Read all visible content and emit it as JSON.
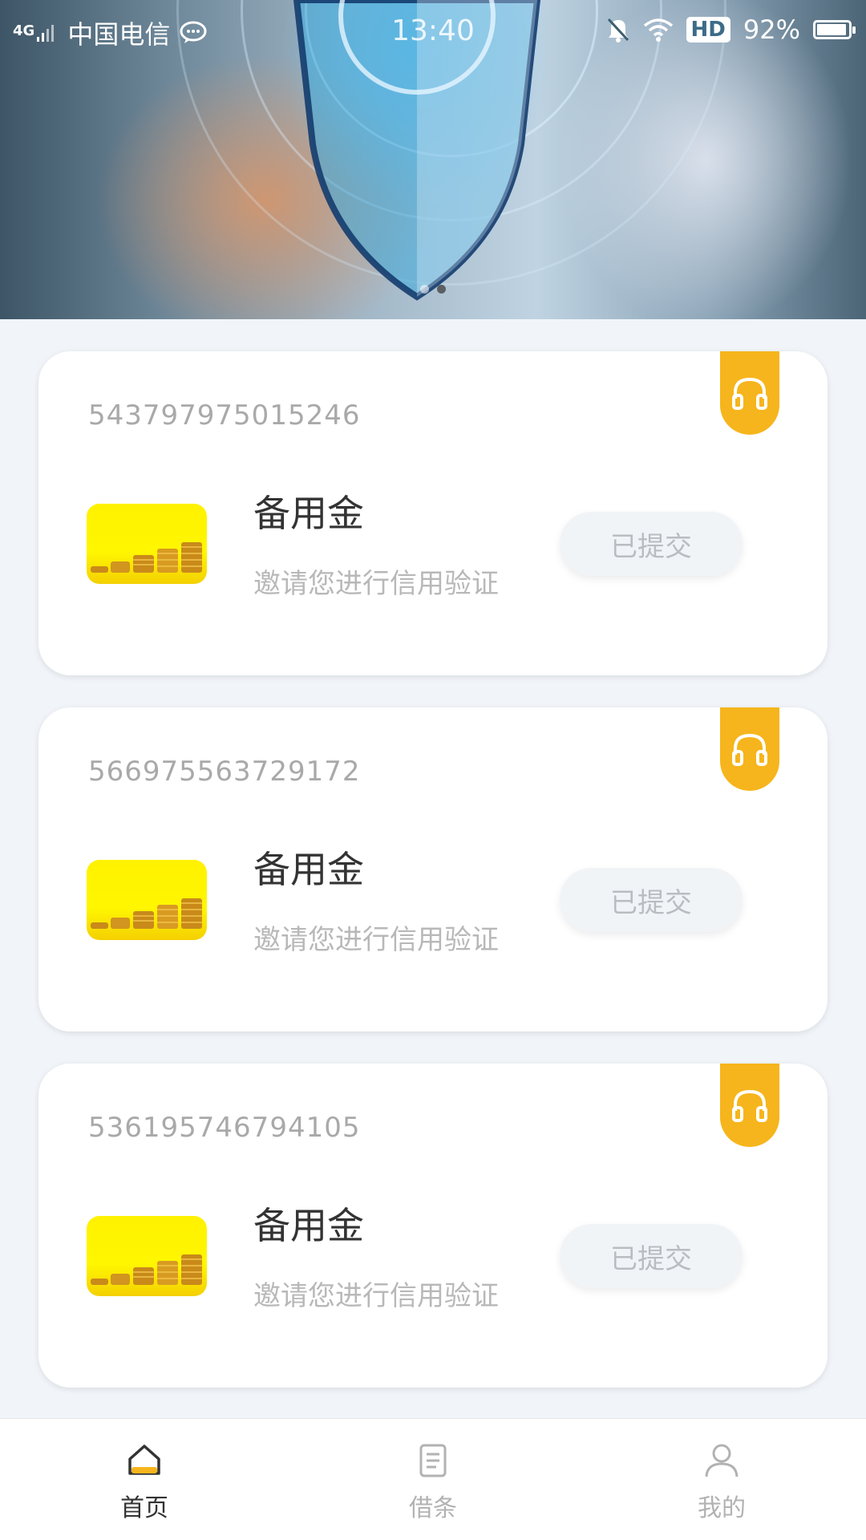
{
  "status_bar": {
    "network": "4G",
    "carrier": "中国电信",
    "time": "13:40",
    "hd": "HD",
    "battery": "92%"
  },
  "banner": {
    "page_count": 2,
    "active_index": 1
  },
  "cards": [
    {
      "number": "543797975015246",
      "title": "备用金",
      "description": "邀请您进行信用验证",
      "button": "已提交"
    },
    {
      "number": "566975563729172",
      "title": "备用金",
      "description": "邀请您进行信用验证",
      "button": "已提交"
    },
    {
      "number": "536195746794105",
      "title": "备用金",
      "description": "邀请您进行信用验证",
      "button": "已提交"
    }
  ],
  "tabs": [
    {
      "label": "首页",
      "icon": "home-icon",
      "active": true
    },
    {
      "label": "借条",
      "icon": "document-icon",
      "active": false
    },
    {
      "label": "我的",
      "icon": "person-icon",
      "active": false
    }
  ],
  "colors": {
    "accent": "#f6b51c",
    "page_bg": "#f1f5f9",
    "text_primary": "#333333",
    "text_muted": "#b8b8b8"
  }
}
